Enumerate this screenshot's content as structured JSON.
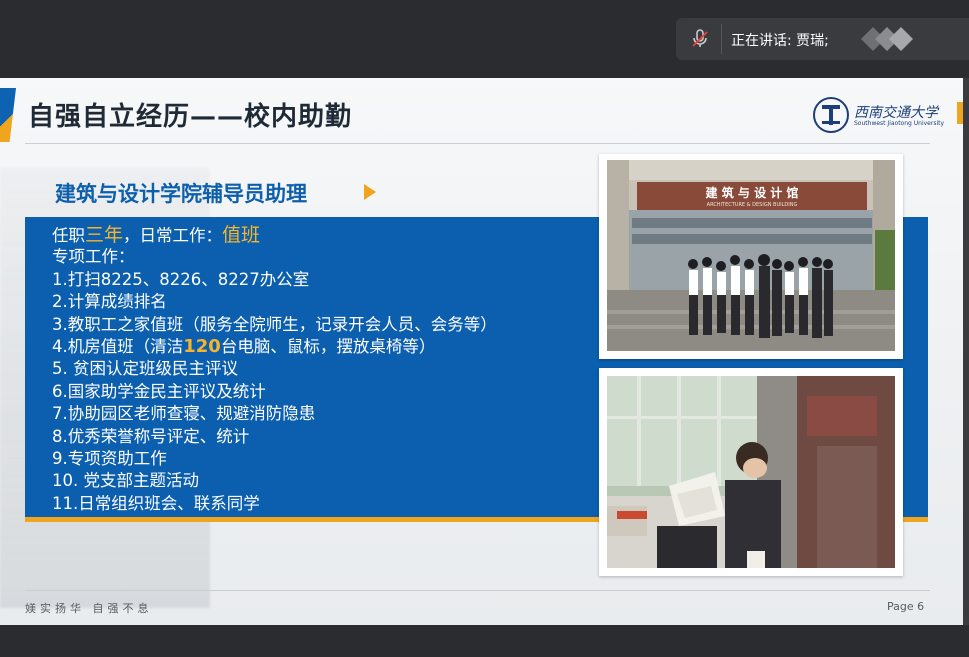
{
  "meeting": {
    "speaking_label": "正在讲话: 贾瑞;"
  },
  "icons": {
    "mic": "mic-muted-icon",
    "avatar": "avatar-icon"
  },
  "slide": {
    "title": "自强自立经历——校内助勤",
    "logo_text": "西南交通大学",
    "logo_sub": "Southwest Jiaotong University",
    "section_heading": "建筑与设计学院辅导员助理",
    "lines": [
      {
        "pre": "任职",
        "hl": "三年",
        "mid": "，日常工作：",
        "hl2": "值班"
      },
      {
        "text": "专项工作："
      },
      {
        "text": "1.打扫8225、8226、8227办公室"
      },
      {
        "text": "2.计算成绩排名"
      },
      {
        "text": "3.教职工之家值班（服务全院师生，记录开会人员、会务等）"
      },
      {
        "pre": "4.机房值班（清洁",
        "hl": "120",
        "mid": "台电脑、鼠标，摆放桌椅等）"
      },
      {
        "text": "5. 贫困认定班级民主评议"
      },
      {
        "text": "6.国家助学金民主评议及统计"
      },
      {
        "text": "7.协助园区老师查寝、规避消防隐患"
      },
      {
        "text": "8.优秀荣誉称号评定、统计"
      },
      {
        "text": "9.专项资助工作"
      },
      {
        "text": "10. 党支部主题活动"
      },
      {
        "text": "11.日常组织班会、联系同学"
      }
    ],
    "photo1_sign": "建 筑 与 设 计 馆",
    "photo1_sign_en": "ARCHITECTURE & DESIGN BUILDING",
    "footer_left": "媄实扬华  自强不息",
    "page_label": "Page 6"
  },
  "colors": {
    "primary_blue": "#0b5fae",
    "accent_gold": "#f0a51e",
    "title_dark": "#1f2a36"
  }
}
